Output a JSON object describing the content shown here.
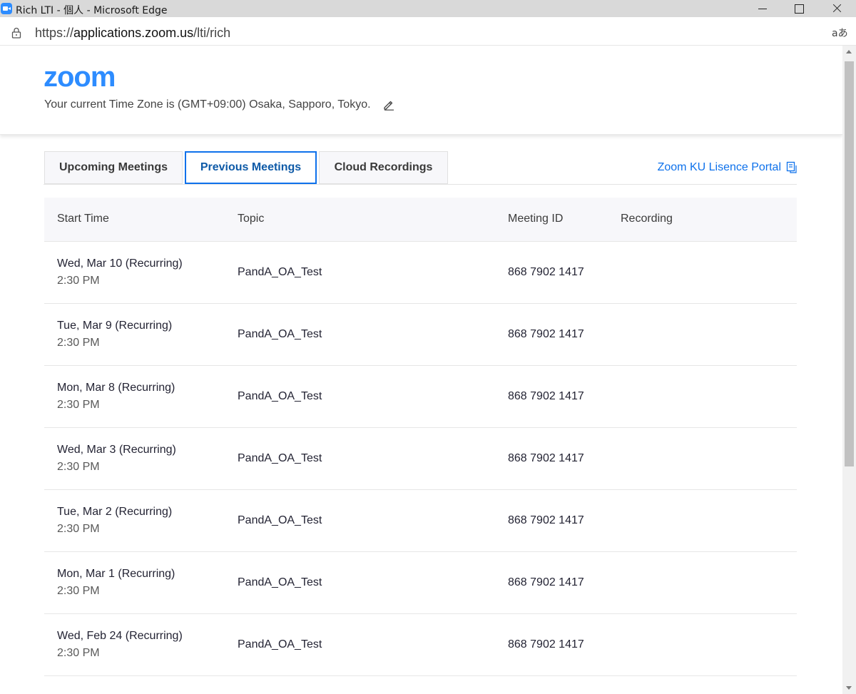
{
  "window": {
    "title": "Rich LTI - 個人 - Microsoft Edge"
  },
  "address_bar": {
    "url_prefix": "https://",
    "url_host": "applications.zoom.us",
    "url_path": "/lti/rich",
    "read_aloud": "aあ"
  },
  "header": {
    "logo": "zoom",
    "timezone_text": "Your current Time Zone is (GMT+09:00) Osaka, Sapporo, Tokyo."
  },
  "tabs": [
    {
      "label": "Upcoming Meetings",
      "active": false
    },
    {
      "label": "Previous Meetings",
      "active": true
    },
    {
      "label": "Cloud Recordings",
      "active": false
    }
  ],
  "portal_link": "Zoom KU Lisence Portal",
  "table": {
    "headers": {
      "start_time": "Start Time",
      "topic": "Topic",
      "meeting_id": "Meeting ID",
      "recording": "Recording"
    },
    "rows": [
      {
        "date": "Wed, Mar 10 (Recurring)",
        "time": "2:30 PM",
        "topic": "PandA_OA_Test",
        "meeting_id": "868 7902 1417"
      },
      {
        "date": "Tue, Mar 9 (Recurring)",
        "time": "2:30 PM",
        "topic": "PandA_OA_Test",
        "meeting_id": "868 7902 1417"
      },
      {
        "date": "Mon, Mar 8 (Recurring)",
        "time": "2:30 PM",
        "topic": "PandA_OA_Test",
        "meeting_id": "868 7902 1417"
      },
      {
        "date": "Wed, Mar 3 (Recurring)",
        "time": "2:30 PM",
        "topic": "PandA_OA_Test",
        "meeting_id": "868 7902 1417"
      },
      {
        "date": "Tue, Mar 2 (Recurring)",
        "time": "2:30 PM",
        "topic": "PandA_OA_Test",
        "meeting_id": "868 7902 1417"
      },
      {
        "date": "Mon, Mar 1 (Recurring)",
        "time": "2:30 PM",
        "topic": "PandA_OA_Test",
        "meeting_id": "868 7902 1417"
      },
      {
        "date": "Wed, Feb 24 (Recurring)",
        "time": "2:30 PM",
        "topic": "PandA_OA_Test",
        "meeting_id": "868 7902 1417"
      }
    ]
  },
  "colors": {
    "accent": "#0e71eb",
    "logo": "#2d8cff",
    "header_bg": "#f7f7fa"
  },
  "icons": {
    "app": "zoom-app-icon",
    "lock": "lock-icon",
    "edit": "pencil-icon",
    "portal": "document-icon"
  }
}
